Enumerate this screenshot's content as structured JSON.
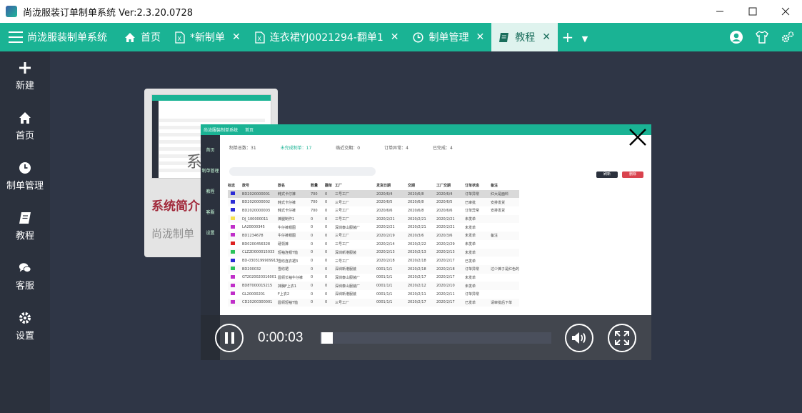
{
  "window": {
    "title": "尚泷服装订单制单系统 Ver:2.3.20.0728"
  },
  "header": {
    "brand": "尚泷服装制单系统",
    "tabs": [
      {
        "label": "首页",
        "icon": "home-icon",
        "closable": false,
        "active": false
      },
      {
        "label": "*新制单",
        "icon": "excel-file-icon",
        "closable": true,
        "active": false
      },
      {
        "label": "连衣裙YJ0021294-翻单1",
        "icon": "excel-file-icon",
        "closable": true,
        "active": false
      },
      {
        "label": "制单管理",
        "icon": "clock-icon",
        "closable": true,
        "active": false
      },
      {
        "label": "教程",
        "icon": "book-icon",
        "closable": true,
        "active": true
      }
    ],
    "add_label": "+",
    "right_icons": [
      "user-icon",
      "tshirt-icon",
      "settings-icon"
    ]
  },
  "sidebar": {
    "items": [
      {
        "label": "新建",
        "icon": "plus-icon"
      },
      {
        "label": "首页",
        "icon": "home-icon"
      },
      {
        "label": "制单管理",
        "icon": "clock-icon"
      },
      {
        "label": "教程",
        "icon": "book-icon"
      },
      {
        "label": "客服",
        "icon": "chat-icon"
      },
      {
        "label": "设置",
        "icon": "gear-icon"
      }
    ]
  },
  "tutorial_card": {
    "overlay_text": "系统",
    "title": "系统简介",
    "subtitle": "尚泷制单"
  },
  "video": {
    "inner_app": {
      "brand": "尚泷服装制单系统",
      "tab": "首页",
      "sidebar": [
        "首页",
        "制单管理",
        "教程",
        "客服",
        "设置"
      ],
      "stats": [
        {
          "label": "制单总数：31",
          "active": false
        },
        {
          "label": "未完成制单：17",
          "active": true
        },
        {
          "label": "临近交期：0",
          "active": false
        },
        {
          "label": "订单异常：4",
          "active": false
        },
        {
          "label": "已完成：4",
          "active": false
        }
      ],
      "refresh_label": "刷新",
      "delete_label": "删除",
      "columns": [
        "标志",
        "款号",
        "款名",
        "数量",
        "翻单",
        "工厂",
        "发货日期",
        "交期",
        "工厂交期",
        "订单状态",
        "备注"
      ],
      "rows": [
        {
          "flag": "#2b2bd6",
          "code": "BD2020000001",
          "name": "韩式卡仔裤",
          "qty": "700",
          "re": "0",
          "factory": "三号工厂",
          "date": "2020/6/4",
          "due": "2020/6/8",
          "fdue": "2020/6/4",
          "status": "订单异常",
          "note": "红大是面料"
        },
        {
          "flag": "#2b2bd6",
          "code": "BD2020000002",
          "name": "韩式卡仔裤",
          "qty": "700",
          "re": "0",
          "factory": "三号工厂",
          "date": "2020/6/5",
          "due": "2020/6/8",
          "fdue": "2020/6/5",
          "status": "已审批",
          "note": "安排发货"
        },
        {
          "flag": "#2b2bd6",
          "code": "BD2020000003",
          "name": "韩式卡仔裤",
          "qty": "700",
          "re": "0",
          "factory": "三号工厂",
          "date": "2020/6/6",
          "due": "2020/6/8",
          "fdue": "2020/6/6",
          "status": "订单异常",
          "note": "安排发货"
        },
        {
          "flag": "#f4e04d",
          "code": "DJ_100000011",
          "name": "裤腿制作1",
          "qty": "0",
          "re": "0",
          "factory": "三号工厂",
          "date": "2020/2/21",
          "due": "2020/2/21",
          "fdue": "2020/2/21",
          "status": "未发单",
          "note": ""
        },
        {
          "flag": "#c02ec9",
          "code": "LA20000345",
          "name": "牛仔裤帽图",
          "qty": "0",
          "re": "0",
          "factory": "深圳泰山服装厂",
          "date": "2020/2/21",
          "due": "2020/2/21",
          "fdue": "2020/2/21",
          "status": "未发单",
          "note": ""
        },
        {
          "flag": "#c02ec9",
          "code": "BD1234678",
          "name": "牛仔裤帽图",
          "qty": "0",
          "re": "0",
          "factory": "三号工厂",
          "date": "2020/2/19",
          "due": "2020/3/6",
          "fdue": "2020/3/6",
          "status": "未发单",
          "note": "备注"
        },
        {
          "flag": "#d22",
          "code": "BD0200456328",
          "name": "硬领裤",
          "qty": "0",
          "re": "0",
          "factory": "三号工厂",
          "date": "2020/2/14",
          "due": "2020/2/22",
          "fdue": "2020/2/29",
          "status": "未发单",
          "note": ""
        },
        {
          "flag": "#2ac25a",
          "code": "CLZ2D000015033",
          "name": "短袖连帽T恤",
          "qty": "0",
          "re": "0",
          "factory": "深圳新港服装",
          "date": "2020/2/13",
          "due": "2020/2/13",
          "fdue": "2020/2/13",
          "status": "未发单",
          "note": ""
        },
        {
          "flag": "#2b2bd6",
          "code": "BD-0303199909913",
          "name": "雪纺连衣裙3",
          "qty": "0",
          "re": "0",
          "factory": "三号工厂",
          "date": "2020/2/18",
          "due": "2020/2/18",
          "fdue": "2020/2/17",
          "status": "已发单",
          "note": ""
        },
        {
          "flag": "#2ac25a",
          "code": "BD200032",
          "name": "雪纺裙",
          "qty": "0",
          "re": "0",
          "factory": "深圳新港服装",
          "date": "0001/1/1",
          "due": "2020/2/18",
          "fdue": "2020/2/18",
          "status": "订单异常",
          "note": "过少裤子是红色的"
        },
        {
          "flag": "#c02ec9",
          "code": "GT2020020316001",
          "name": "圆领长袖牛仔裤",
          "qty": "0",
          "re": "0",
          "factory": "深圳泰山服装厂",
          "date": "0001/1/1",
          "due": "2020/2/17",
          "fdue": "2020/2/17",
          "status": "未发单",
          "note": ""
        },
        {
          "flag": "#c02ec9",
          "code": "BD8T000015215",
          "name": "抹胸F上衣1",
          "qty": "0",
          "re": "0",
          "factory": "深圳泰山服装厂",
          "date": "0001/1/1",
          "due": "2020/2/12",
          "fdue": "2020/2/10",
          "status": "未发单",
          "note": ""
        },
        {
          "flag": "#c02ec9",
          "code": "GL20000201",
          "name": "F上衣2",
          "qty": "0",
          "re": "0",
          "factory": "深圳新港服装",
          "date": "0001/1/1",
          "due": "2020/2/11",
          "fdue": "2020/2/11",
          "status": "订单异常",
          "note": ""
        },
        {
          "flag": "#c02ec9",
          "code": "CD20200300001",
          "name": "圆领短袖T恤",
          "qty": "0",
          "re": "0",
          "factory": "三号工厂",
          "date": "0001/1/1",
          "due": "2020/2/17",
          "fdue": "2020/2/17",
          "status": "已发单",
          "note": "请审批后下单"
        }
      ]
    },
    "controls": {
      "time": "0:00:03",
      "progress": 0.03
    }
  }
}
